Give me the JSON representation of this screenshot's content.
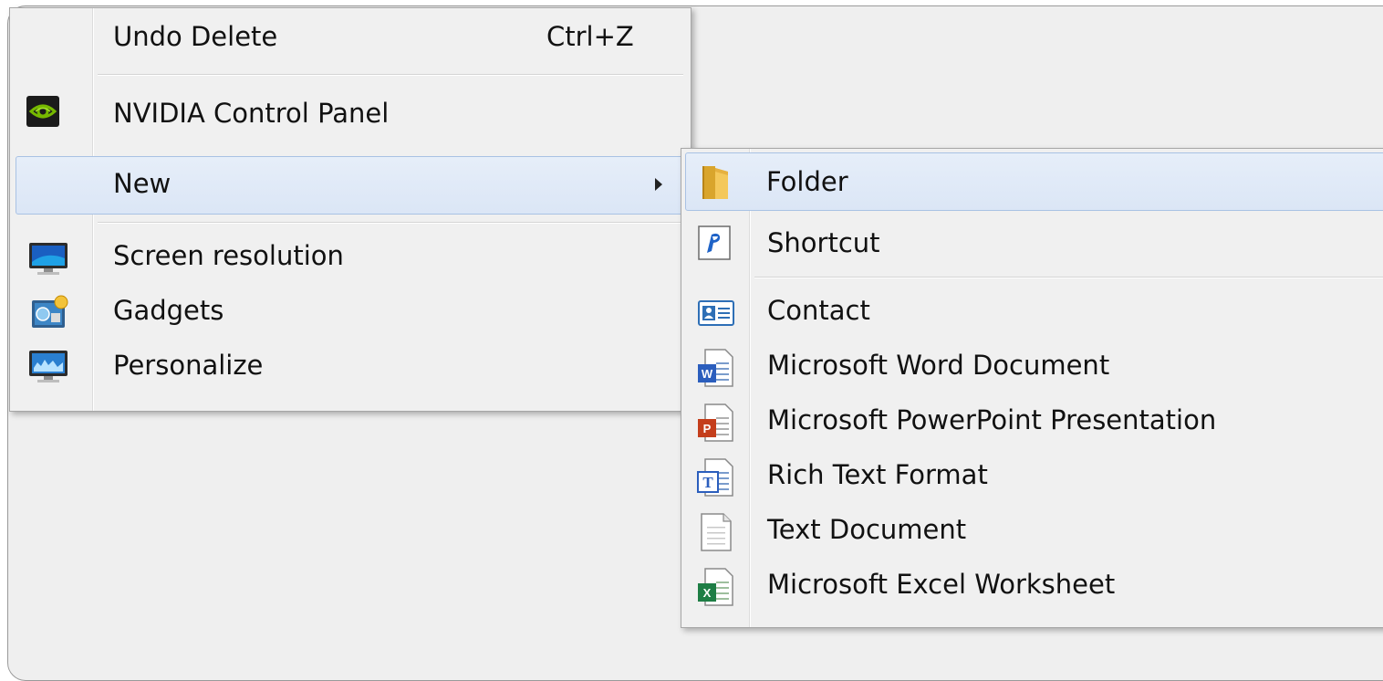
{
  "context_menu": {
    "items": [
      {
        "label": "Undo Delete",
        "shortcut": "Ctrl+Z",
        "icon": null
      },
      {
        "label": "NVIDIA Control Panel",
        "icon": "nvidia-icon"
      },
      {
        "label": "New",
        "icon": null,
        "has_submenu": true,
        "highlighted": true
      },
      {
        "label": "Screen resolution",
        "icon": "monitor-icon"
      },
      {
        "label": "Gadgets",
        "icon": "gadgets-icon"
      },
      {
        "label": "Personalize",
        "icon": "personalize-icon"
      }
    ]
  },
  "new_submenu": {
    "items": [
      {
        "label": "Folder",
        "icon": "folder-icon",
        "highlighted": true
      },
      {
        "label": "Shortcut",
        "icon": "shortcut-icon"
      },
      {
        "label": "Contact",
        "icon": "contact-icon"
      },
      {
        "label": "Microsoft Word Document",
        "icon": "word-document-icon"
      },
      {
        "label": "Microsoft PowerPoint Presentation",
        "icon": "powerpoint-presentation-icon"
      },
      {
        "label": "Rich Text Format",
        "icon": "rich-text-icon"
      },
      {
        "label": "Text Document",
        "icon": "text-document-icon"
      },
      {
        "label": "Microsoft Excel Worksheet",
        "icon": "excel-worksheet-icon"
      }
    ]
  },
  "colors": {
    "menu_background": "#f0f0f0",
    "highlight_background": "#dde8f7",
    "highlight_border": "#a9c2e4",
    "nvidia_green": "#76b900"
  }
}
